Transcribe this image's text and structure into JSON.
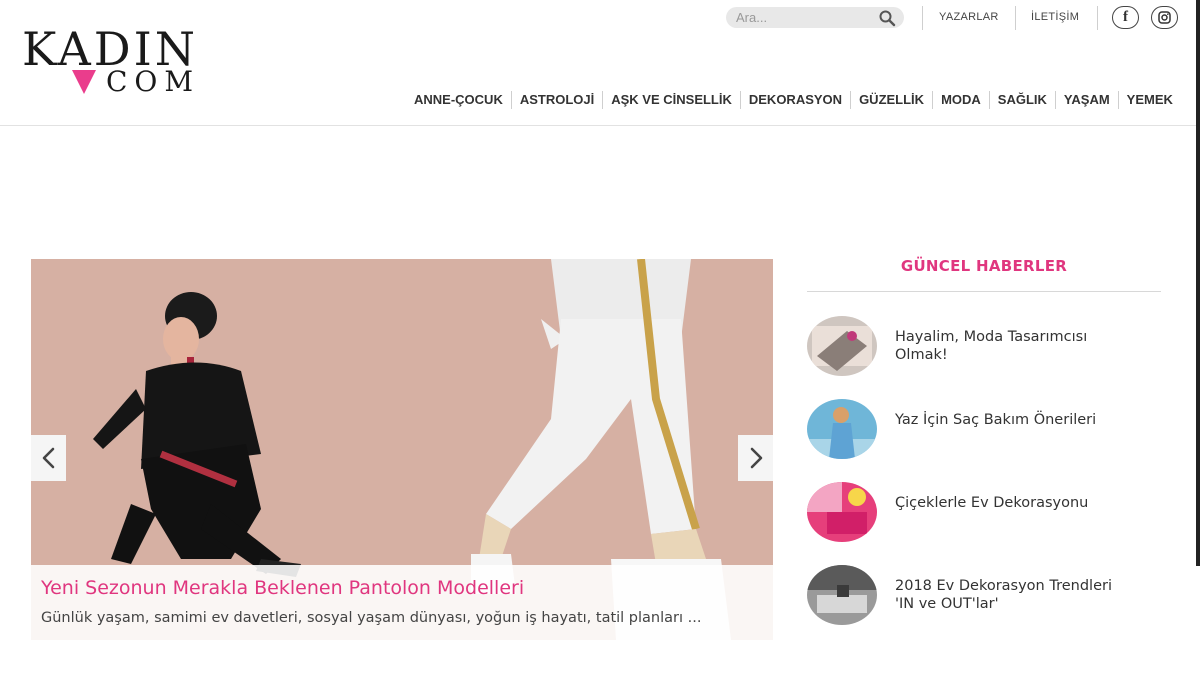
{
  "logo": {
    "word": "KADIN",
    "suffix": "COM",
    "accent_color": "#ea3d8c"
  },
  "search": {
    "placeholder": "Ara...",
    "icon": "search-icon"
  },
  "top_links": {
    "authors": "YAZARLAR",
    "contact": "İLETİŞİM"
  },
  "social": {
    "facebook": "f",
    "instagram_icon": "instagram-icon"
  },
  "nav": {
    "items": [
      "ANNE-ÇOCUK",
      "ASTROLOJİ",
      "AŞK VE CİNSELLİK",
      "DEKORASYON",
      "GÜZELLİK",
      "MODA",
      "SAĞLIK",
      "YAŞAM",
      "YEMEK"
    ]
  },
  "slider": {
    "title": "Yeni Sezonun Merakla Beklenen Pantolon Modelleri",
    "excerpt": "Günlük yaşam, samimi ev davetleri, sosyal yaşam dünyası, yoğun iş hayatı, tatil planları ...",
    "prev_icon": "chevron-left-icon",
    "next_icon": "chevron-right-icon"
  },
  "sidebar": {
    "title": "GÜNCEL HABERLER",
    "items": [
      {
        "line1": "Hayalim, Moda Tasarımcısı",
        "line2": "Olmak!"
      },
      {
        "line1": "Yaz İçin Saç Bakım Önerileri",
        "line2": ""
      },
      {
        "line1": "Çiçeklerle Ev Dekorasyonu",
        "line2": ""
      },
      {
        "line1": "2018 Ev Dekorasyon Trendleri",
        "line2": "'IN ve OUT'lar'"
      }
    ]
  },
  "colors": {
    "accent": "#e0367f",
    "slide_bg": "#d9b3a6"
  }
}
